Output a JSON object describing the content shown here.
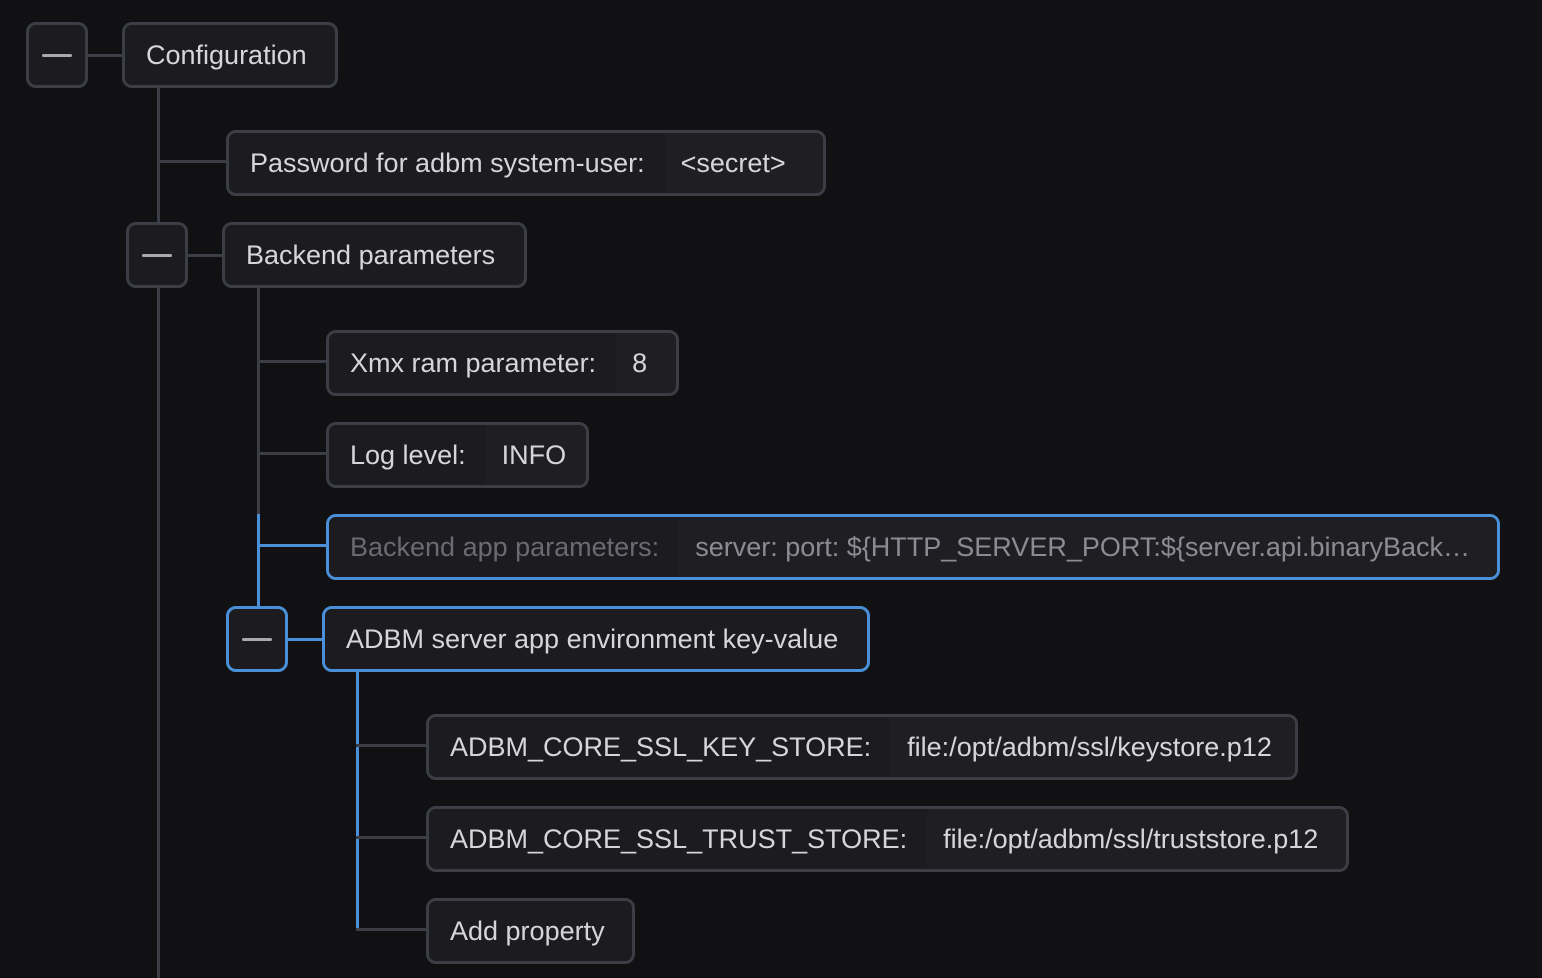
{
  "tree": {
    "root": {
      "label": "Configuration"
    },
    "password": {
      "label": "Password for adbm system-user:",
      "value": "<secret>"
    },
    "backend": {
      "label": "Backend parameters",
      "xmx": {
        "label": "Xmx ram parameter:",
        "value": "8"
      },
      "log_level": {
        "label": "Log level:",
        "value": "INFO"
      },
      "app_params": {
        "label": "Backend app parameters:",
        "value": "server: port: ${HTTP_SERVER_PORT:${server.api.binaryBack…"
      },
      "env": {
        "label": "ADBM server app environment key-value",
        "key_store": {
          "label": "ADBM_CORE_SSL_KEY_STORE:",
          "value": "file:/opt/adbm/ssl/keystore.p12"
        },
        "trust_store": {
          "label": "ADBM_CORE_SSL_TRUST_STORE:",
          "value": "file:/opt/adbm/ssl/truststore.p12"
        },
        "add_property": {
          "label": "Add property"
        }
      }
    }
  },
  "icons": {
    "collapse": "minus-icon"
  },
  "colors": {
    "background": "#111113",
    "node_background": "#1c1c20",
    "border": "#3b3e44",
    "accent": "#4a90d9",
    "text": "#d6d6da",
    "muted_text": "#6a6b72"
  }
}
